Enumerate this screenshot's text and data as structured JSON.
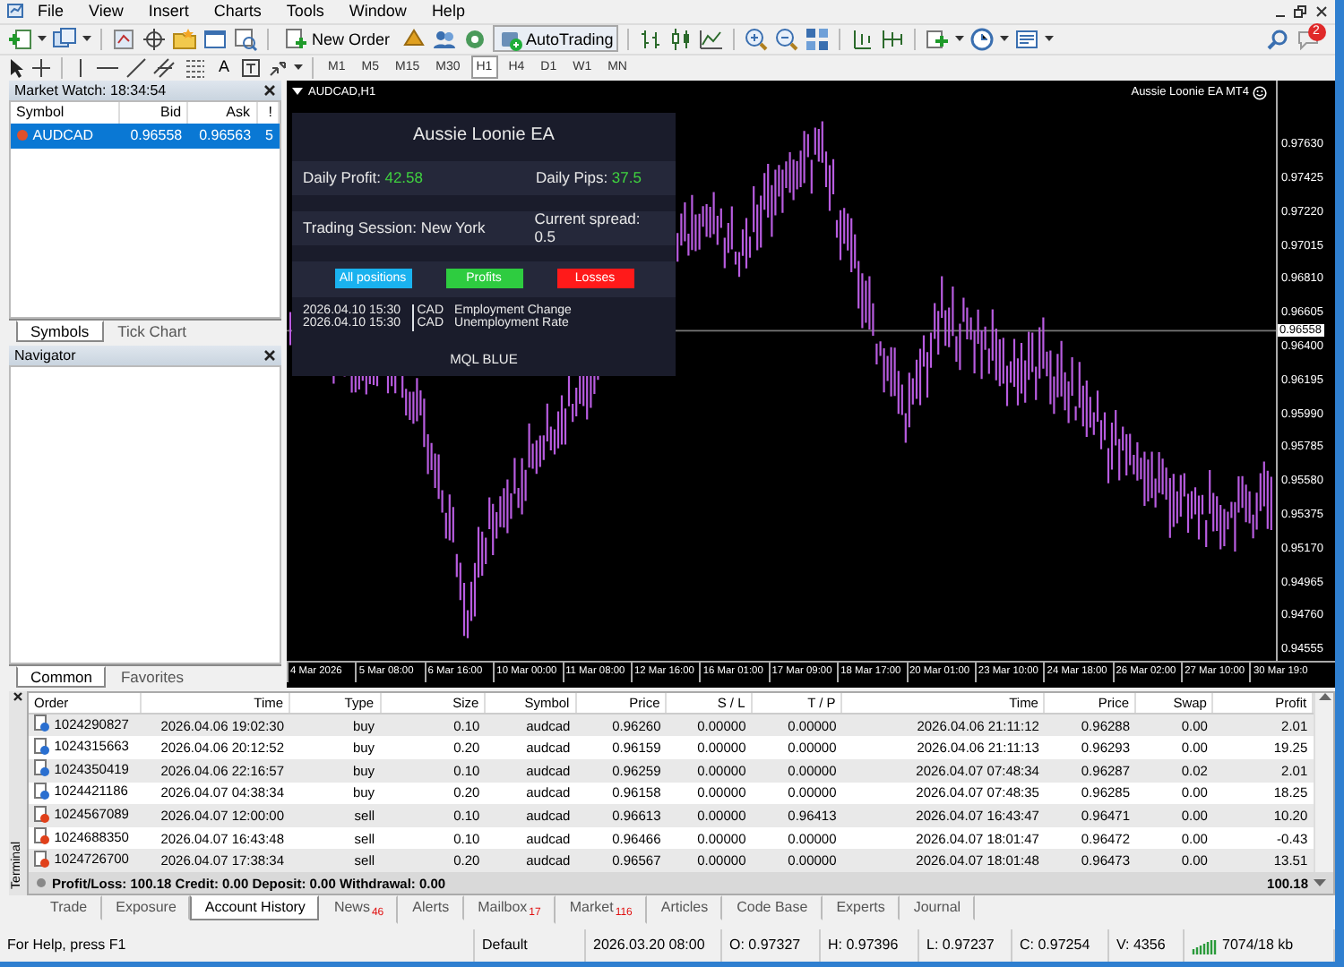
{
  "menu": [
    "File",
    "View",
    "Insert",
    "Charts",
    "Tools",
    "Window",
    "Help"
  ],
  "toolbar": {
    "new_order": "New Order",
    "auto_trading": "AutoTrading",
    "notification_count": "2",
    "text_tool": "A"
  },
  "timeframes": [
    {
      "label": "M1",
      "selected": false
    },
    {
      "label": "M5",
      "selected": false
    },
    {
      "label": "M15",
      "selected": false
    },
    {
      "label": "M30",
      "selected": false
    },
    {
      "label": "H1",
      "selected": true
    },
    {
      "label": "H4",
      "selected": false
    },
    {
      "label": "D1",
      "selected": false
    },
    {
      "label": "W1",
      "selected": false
    },
    {
      "label": "MN",
      "selected": false
    }
  ],
  "market_watch": {
    "title": "Market Watch: 18:34:54",
    "columns": [
      "Symbol",
      "Bid",
      "Ask",
      "!"
    ],
    "rows": [
      {
        "symbol": "AUDCAD",
        "bid": "0.96558",
        "ask": "0.96563",
        "spread": "5",
        "selected": true
      }
    ],
    "tabs": [
      {
        "label": "Symbols",
        "selected": true
      },
      {
        "label": "Tick Chart",
        "selected": false
      }
    ]
  },
  "navigator": {
    "title": "Navigator",
    "tabs": [
      {
        "label": "Common",
        "selected": true
      },
      {
        "label": "Favorites",
        "selected": false
      }
    ]
  },
  "chart": {
    "title": "AUDCAD,H1",
    "ea_label": "Aussie Loonie EA MT4",
    "current_price": "0.96558",
    "price_labels": [
      "0.97630",
      "0.97425",
      "0.97220",
      "0.97015",
      "0.96810",
      "0.96605",
      "0.96400",
      "0.96195",
      "0.95990",
      "0.95785",
      "0.95580",
      "0.95375",
      "0.95170",
      "0.94965",
      "0.94760",
      "0.94555"
    ],
    "time_labels": [
      "4 Mar 2026",
      "5 Mar 08:00",
      "6 Mar 16:00",
      "10 Mar 00:00",
      "11 Mar 08:00",
      "12 Mar 16:00",
      "16 Mar 01:00",
      "17 Mar 09:00",
      "18 Mar 17:00",
      "20 Mar 01:00",
      "23 Mar 10:00",
      "24 Mar 18:00",
      "26 Mar 02:00",
      "27 Mar 10:00",
      "30 Mar 19:0"
    ],
    "panel": {
      "title": "Aussie Loonie EA",
      "daily_profit_label": "Daily Profit:",
      "daily_profit": "42.58",
      "daily_pips_label": "Daily Pips:",
      "daily_pips": "37.5",
      "session": "Trading Session: New York",
      "spread": "Current spread: 0.5",
      "buttons": [
        {
          "label": "All positions",
          "color": "#1ab2ef"
        },
        {
          "label": "Profits",
          "color": "#2ecc40"
        },
        {
          "label": "Losses",
          "color": "#ff1a1a"
        }
      ],
      "news": [
        {
          "time": "2026.04.10 15:30",
          "currency": "CAD",
          "event": "Employment Change"
        },
        {
          "time": "2026.04.10 15:30",
          "currency": "CAD",
          "event": "Unemployment Rate"
        }
      ],
      "footer": "MQL BLUE"
    }
  },
  "terminal": {
    "label": "Terminal",
    "columns": [
      "Order",
      "Time",
      "Type",
      "Size",
      "Symbol",
      "Price",
      "S / L",
      "T / P",
      "Time",
      "Price",
      "Swap",
      "Profit"
    ],
    "rows": [
      {
        "kind": "buy",
        "cells": [
          "1024290827",
          "2026.04.06 19:02:30",
          "buy",
          "0.10",
          "audcad",
          "0.96260",
          "0.00000",
          "0.00000",
          "2026.04.06 21:11:12",
          "0.96288",
          "0.00",
          "2.01"
        ]
      },
      {
        "kind": "buy",
        "cells": [
          "1024315663",
          "2026.04.06 20:12:52",
          "buy",
          "0.20",
          "audcad",
          "0.96159",
          "0.00000",
          "0.00000",
          "2026.04.06 21:11:13",
          "0.96293",
          "0.00",
          "19.25"
        ]
      },
      {
        "kind": "buy",
        "cells": [
          "1024350419",
          "2026.04.06 22:16:57",
          "buy",
          "0.10",
          "audcad",
          "0.96259",
          "0.00000",
          "0.00000",
          "2026.04.07 07:48:34",
          "0.96287",
          "0.02",
          "2.01"
        ]
      },
      {
        "kind": "buy",
        "cells": [
          "1024421186",
          "2026.04.07 04:38:34",
          "buy",
          "0.20",
          "audcad",
          "0.96158",
          "0.00000",
          "0.00000",
          "2026.04.07 07:48:35",
          "0.96285",
          "0.00",
          "18.25"
        ]
      },
      {
        "kind": "sell",
        "cells": [
          "1024567089",
          "2026.04.07 12:00:00",
          "sell",
          "0.10",
          "audcad",
          "0.96613",
          "0.00000",
          "0.96413",
          "2026.04.07 16:43:47",
          "0.96471",
          "0.00",
          "10.20"
        ]
      },
      {
        "kind": "sell",
        "cells": [
          "1024688350",
          "2026.04.07 16:43:48",
          "sell",
          "0.10",
          "audcad",
          "0.96466",
          "0.00000",
          "0.00000",
          "2026.04.07 18:01:47",
          "0.96472",
          "0.00",
          "-0.43"
        ]
      },
      {
        "kind": "sell",
        "cells": [
          "1024726700",
          "2026.04.07 17:38:34",
          "sell",
          "0.20",
          "audcad",
          "0.96567",
          "0.00000",
          "0.00000",
          "2026.04.07 18:01:48",
          "0.96473",
          "0.00",
          "13.51"
        ]
      }
    ],
    "summary": "Profit/Loss: 100.18  Credit: 0.00  Deposit: 0.00  Withdrawal: 0.00",
    "total": "100.18",
    "tabs": [
      {
        "label": "Trade",
        "selected": false
      },
      {
        "label": "Exposure",
        "selected": false
      },
      {
        "label": "Account History",
        "selected": true
      },
      {
        "label": "News",
        "count": "46",
        "selected": false
      },
      {
        "label": "Alerts",
        "selected": false
      },
      {
        "label": "Mailbox",
        "count": "17",
        "selected": false
      },
      {
        "label": "Market",
        "count": "116",
        "selected": false
      },
      {
        "label": "Articles",
        "selected": false
      },
      {
        "label": "Code Base",
        "selected": false
      },
      {
        "label": "Experts",
        "selected": false
      },
      {
        "label": "Journal",
        "selected": false
      }
    ]
  },
  "status_bar": [
    "For Help, press F1",
    "Default",
    "2026.03.20 08:00",
    "O: 0.97327",
    "H: 0.97396",
    "L: 0.97237",
    "C: 0.97254",
    "V: 4356",
    "7074/18 kb"
  ]
}
